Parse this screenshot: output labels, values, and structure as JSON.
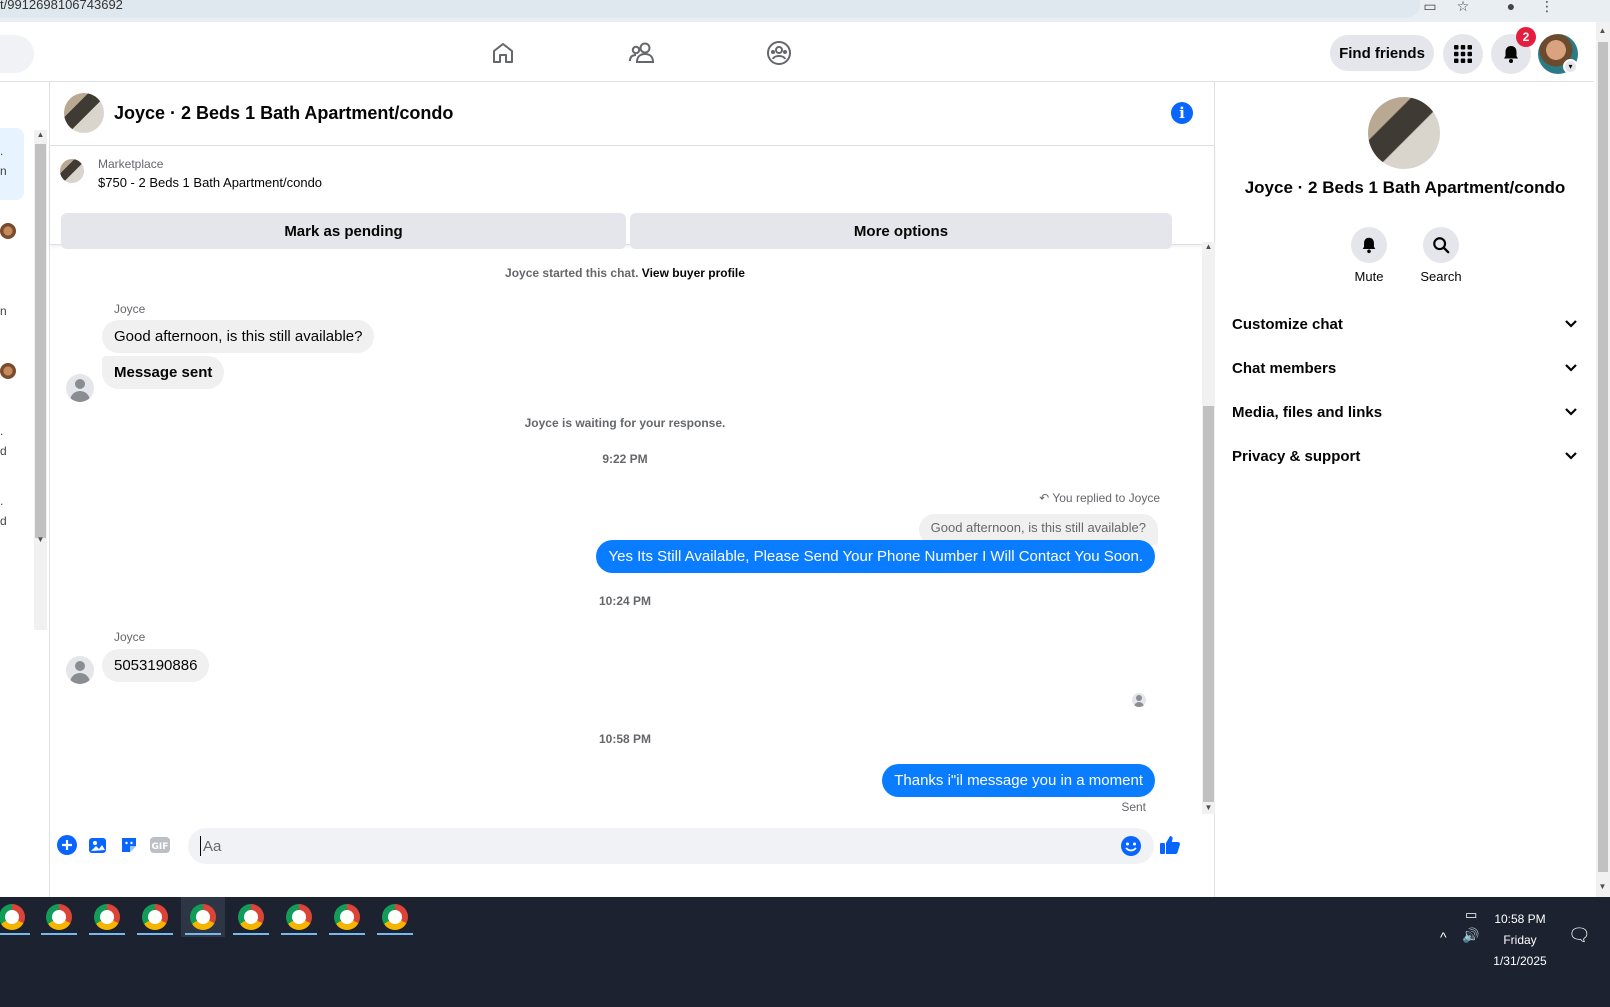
{
  "browser": {
    "url": "t/9912698106743692"
  },
  "topbar": {
    "find_friends": "Find friends",
    "notification_count": "2",
    "icons": [
      "home-icon",
      "friends-icon",
      "groups-icon",
      "apps-grid-icon",
      "bell-icon",
      "account-avatar"
    ]
  },
  "chat": {
    "title": "Joyce · 2 Beds 1 Bath Apartment/condo",
    "marketplace": {
      "label": "Marketplace",
      "listing": "$750 - 2 Beds 1 Bath Apartment/condo",
      "mark_pending": "Mark as pending",
      "more_options": "More options"
    },
    "started_text": "Joyce started this chat.",
    "view_profile": "View buyer profile",
    "sender_name_1": "Joyce",
    "msg_in_1": "Good afternoon, is this still available?",
    "msg_in_2": "Message sent",
    "waiting_text": "Joyce is waiting for your response.",
    "time_1": "9:22 PM",
    "replied_to": "You replied to Joyce",
    "reply_quote": "Good afternoon, is this still available?",
    "msg_out_1": "Yes Its Still Available, Please Send Your Phone Number I Will Contact You Soon.",
    "time_2": "10:24 PM",
    "sender_name_2": "Joyce",
    "msg_in_3": "5053190886",
    "time_3": "10:58 PM",
    "msg_out_2": "Thanks i\"il message you in a moment",
    "status": "Sent",
    "composer_placeholder": "Aa"
  },
  "details": {
    "title": "Joyce · 2 Beds 1 Bath Apartment/condo",
    "mute": "Mute",
    "search": "Search",
    "sections": [
      "Customize chat",
      "Chat members",
      "Media, files and links",
      "Privacy & support"
    ]
  },
  "taskbar": {
    "time": "10:58 PM",
    "day": "Friday",
    "date": "1/31/2025"
  },
  "colors": {
    "accent": "#0866ff",
    "bubble_out": "#0a7cff",
    "bubble_in": "#f0f0f0",
    "badge": "#e41e3f",
    "taskbar": "#1c2230"
  }
}
